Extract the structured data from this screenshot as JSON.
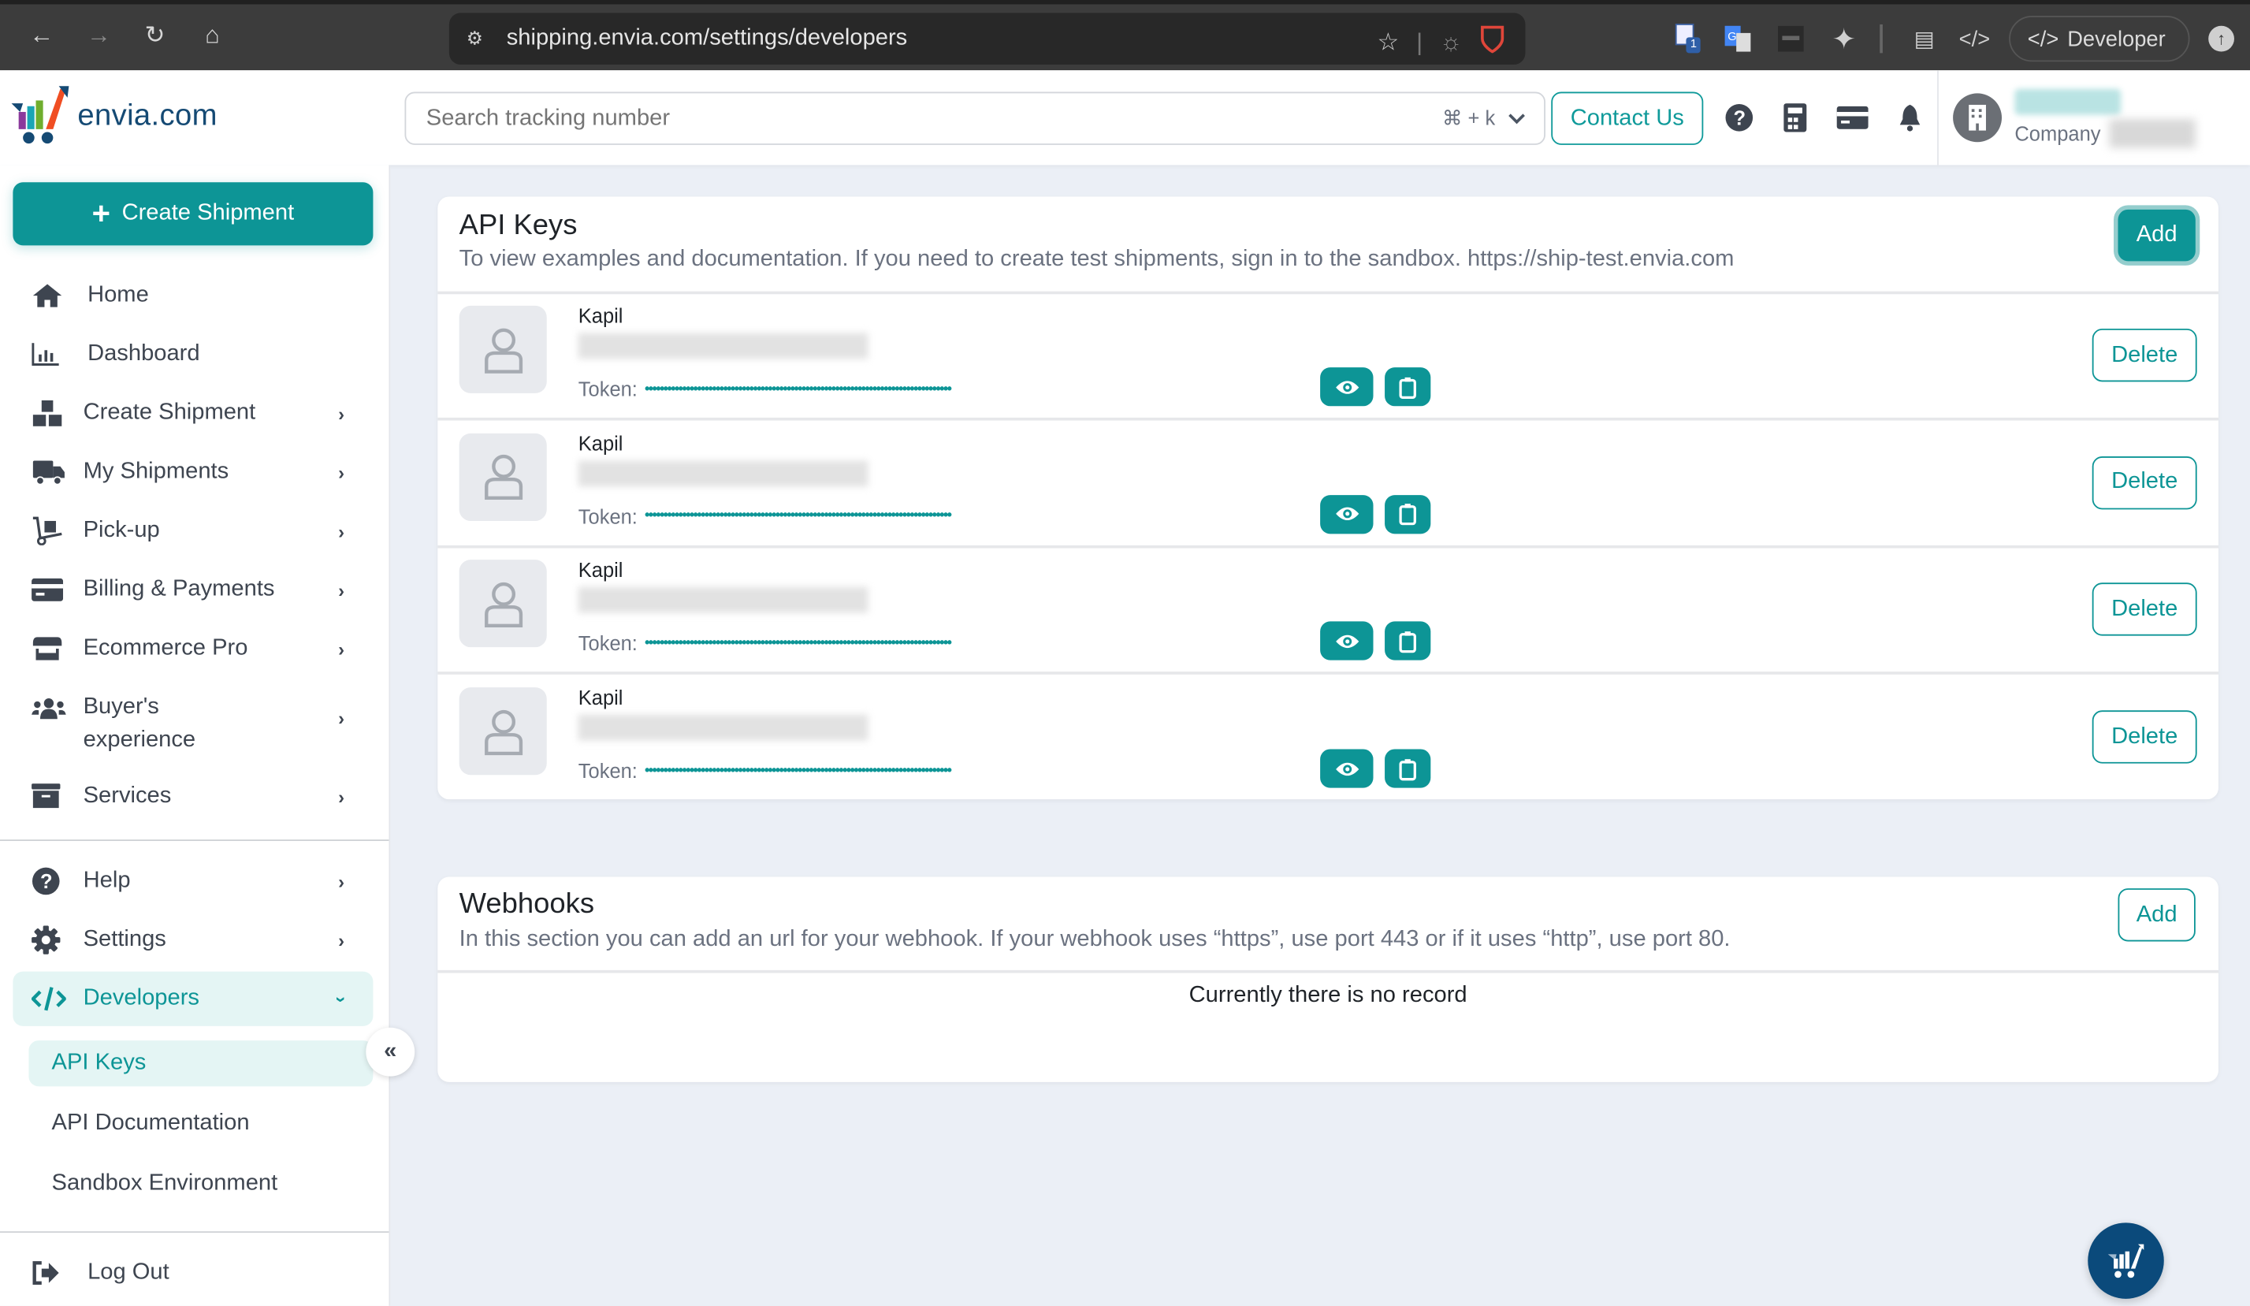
{
  "browser": {
    "url": "shipping.envia.com/settings/developers",
    "extension_badge": "1",
    "profile_label": "Developer"
  },
  "header": {
    "logo_text": "envia.com",
    "search_placeholder": "Search tracking number",
    "search_shortcut": "⌘ + k",
    "contact_label": "Contact Us",
    "company_label": "Company"
  },
  "sidebar": {
    "create_button": "Create Shipment",
    "items": [
      {
        "label": "Home",
        "icon": "home-icon"
      },
      {
        "label": "Dashboard",
        "icon": "chart-icon"
      },
      {
        "label": "Create Shipment",
        "icon": "boxes-icon"
      },
      {
        "label": "My Shipments",
        "icon": "truck-icon"
      },
      {
        "label": "Pick-up",
        "icon": "dolly-icon"
      },
      {
        "label": "Billing & Payments",
        "icon": "credit-card-icon"
      },
      {
        "label": "Ecommerce Pro",
        "icon": "store-icon"
      },
      {
        "label": "Buyer's experience",
        "icon": "users-icon"
      },
      {
        "label": "Services",
        "icon": "archive-icon"
      },
      {
        "label": "Help",
        "icon": "question-icon"
      },
      {
        "label": "Settings",
        "icon": "gear-icon"
      },
      {
        "label": "Developers",
        "icon": "code-icon"
      }
    ],
    "developers_sub": [
      "API Keys",
      "API Documentation",
      "Sandbox Environment"
    ],
    "logout": "Log Out"
  },
  "api_keys": {
    "title": "API Keys",
    "description": "To view examples and documentation. If you need to create test shipments, sign in to the sandbox. https://ship-test.envia.com",
    "add_label": "Add",
    "token_label": "Token:",
    "masked_token": "••••••••••••••••••••••••••••••••••••••••••••••••••••••••••••••••••••••••••••••••••",
    "delete_label": "Delete",
    "keys": [
      {
        "name": "Kapil"
      },
      {
        "name": "Kapil"
      },
      {
        "name": "Kapil"
      },
      {
        "name": "Kapil"
      }
    ]
  },
  "webhooks": {
    "title": "Webhooks",
    "description": "In this section you can add an url for your webhook. If your webhook uses “https”, use port 443 or if it uses “http”, use port 80.",
    "add_label": "Add",
    "empty_message": "Currently there is no record"
  },
  "colors": {
    "accent": "#0d9596",
    "brand_dark": "#0b4a7b",
    "active_bg": "#e4f5f4"
  }
}
